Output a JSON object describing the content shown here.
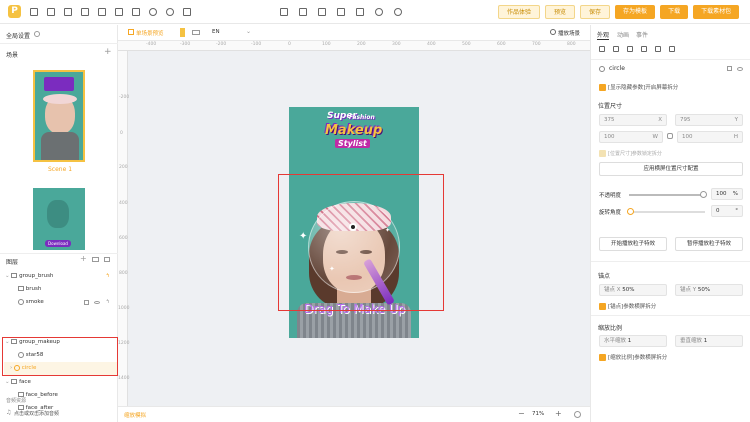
{
  "topbar": {
    "buttons": {
      "works": "作品体验",
      "preview": "预览",
      "save": "保存",
      "save_template": "存为模板",
      "download": "下载",
      "download_ad": "下载素材包"
    }
  },
  "left": {
    "global_settings": "全局设置",
    "scene_title": "场景",
    "scene1_label": "Scene 1",
    "layers_title": "图层",
    "layers": [
      {
        "name": "group_brush"
      },
      {
        "name": "brush"
      },
      {
        "name": "smoke"
      },
      {
        "name": "group_makeup"
      },
      {
        "name": "star58"
      },
      {
        "name": "circle"
      },
      {
        "name": "face"
      },
      {
        "name": "face_before"
      },
      {
        "name": "face_after"
      }
    ],
    "audio_title": "音频资源",
    "audio_item": "点击或双击添加音频"
  },
  "canvas": {
    "toolbar_item": "单场景预览",
    "lang": "EN",
    "play_scene": "播放场景",
    "ruler_top": [
      "-400",
      "-300",
      "-200",
      "-100",
      "0",
      "100",
      "200",
      "300",
      "400",
      "500",
      "600",
      "700",
      "800",
      "900",
      "1000",
      "1100",
      "1200",
      "1300",
      "1400",
      "1500"
    ],
    "ruler_left": [
      "-200",
      "0",
      "200",
      "400",
      "600",
      "800",
      "1000",
      "1200",
      "1400",
      "1600"
    ],
    "ad_title_1": "Super",
    "ad_title_2": "Fashion",
    "ad_title_3": "Makeup",
    "ad_title_4": "Stylist",
    "drag_text": "Drag To Make Up",
    "download_label": "Download",
    "bottom_left": "缩放模拟",
    "zoom": "71%"
  },
  "right": {
    "tabs": [
      "外观",
      "动画",
      "事件"
    ],
    "element_name": "circle",
    "show_frame_label": "[显示隐藏参数]开启屏幕拆分",
    "position_size": "位置尺寸",
    "x_value": "375",
    "x_label": "X",
    "y_value": "795",
    "y_label": "Y",
    "w_value": "100",
    "w_label": "W",
    "h_value": "100",
    "h_label": "H",
    "keep_ratio": "[位置尺寸]参数锁定拆分",
    "apply_btn": "应用横屏位置尺寸配置",
    "opacity_label": "不透明度",
    "opacity_value": "100",
    "opacity_unit": "%",
    "rotation_label": "旋转角度",
    "rotation_value": "0",
    "rotation_unit": "°",
    "particle_start": "开始播放粒子特效",
    "particle_stop": "暂停播放粒子特效",
    "anchor_title": "锚点",
    "anchor_x": "锚点 X",
    "anchor_x_val": "50%",
    "anchor_y": "锚点 Y",
    "anchor_y_val": "50%",
    "anchor_chk": "[锚点]参数横屏拆分",
    "scale_title": "缩放比例",
    "scale_h": "水平缩放",
    "scale_h_val": "1",
    "scale_v": "垂直缩放",
    "scale_v_val": "1",
    "scale_chk": "[缩放比例]参数横屏拆分"
  }
}
